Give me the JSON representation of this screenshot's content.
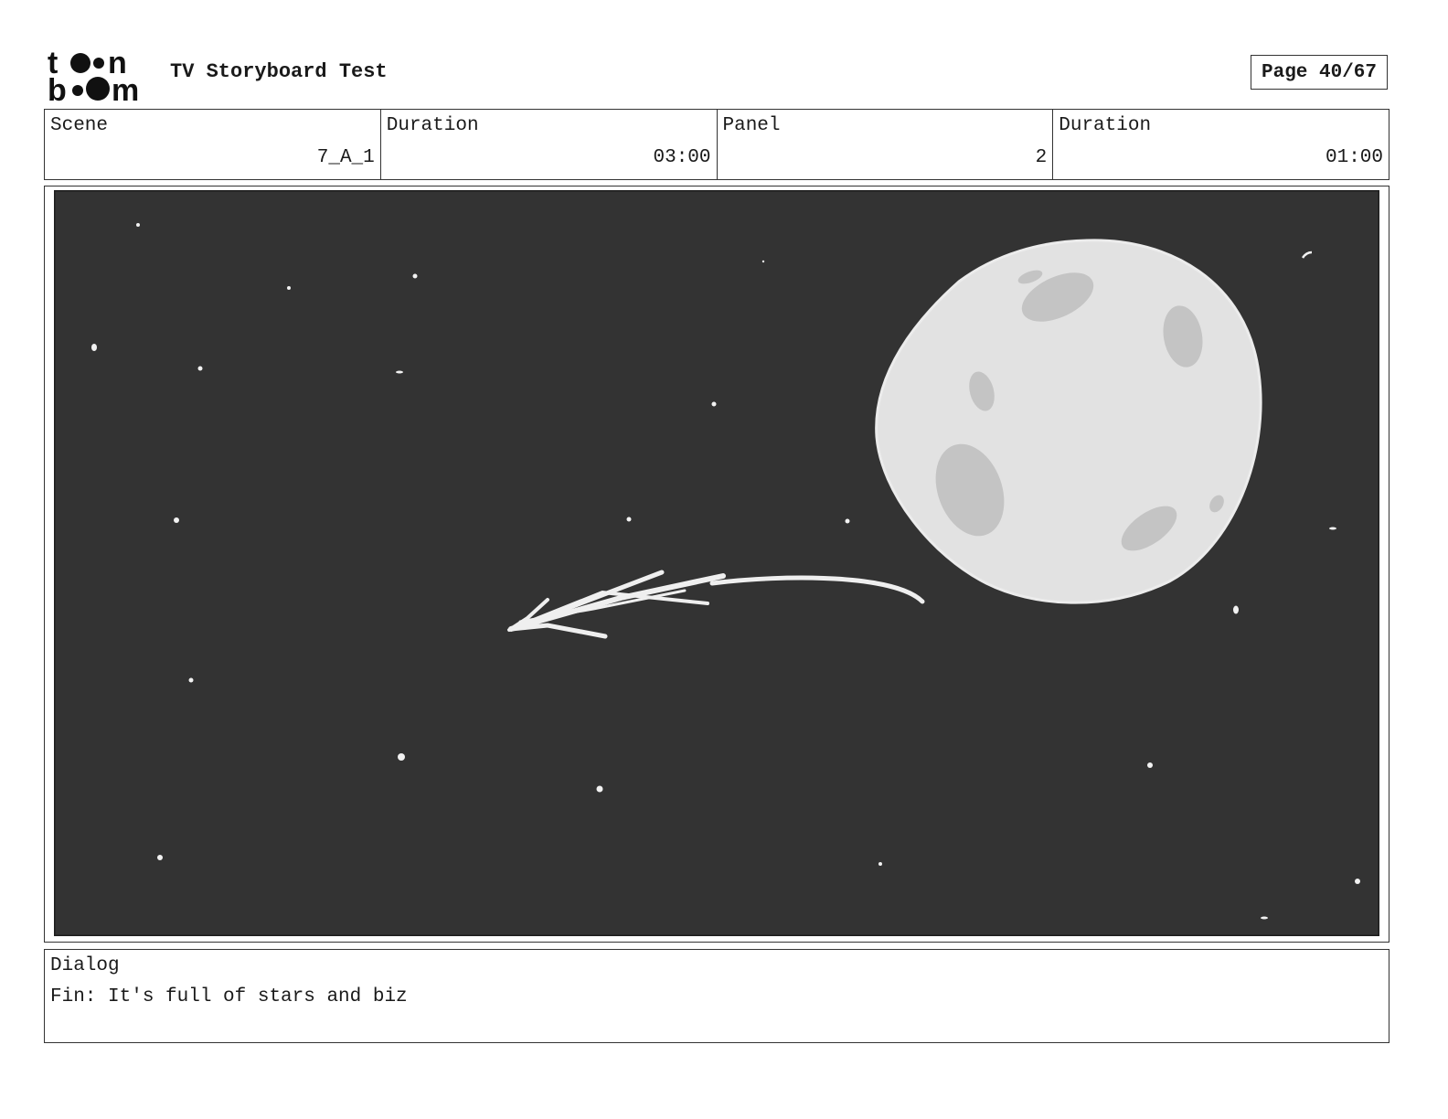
{
  "header": {
    "logo_text": "toon boom",
    "title": "TV Storyboard Test",
    "page_label": "Page 40/67"
  },
  "info": {
    "scene_label": "Scene",
    "scene_value": "7_A_1",
    "scene_duration_label": "Duration",
    "scene_duration_value": "03:00",
    "panel_label": "Panel",
    "panel_value": "2",
    "panel_duration_label": "Duration",
    "panel_duration_value": "01:00"
  },
  "panel": {
    "icons": [
      "moon-illustration",
      "shooting-star-arrow",
      "stars"
    ],
    "colors": {
      "sky": "#333333",
      "moon": "#e2e2e2",
      "crater": "#c4c4c4",
      "star": "#f2f2f2"
    }
  },
  "dialog": {
    "label": "Dialog",
    "text": "Fin: It's full of stars and biz"
  }
}
